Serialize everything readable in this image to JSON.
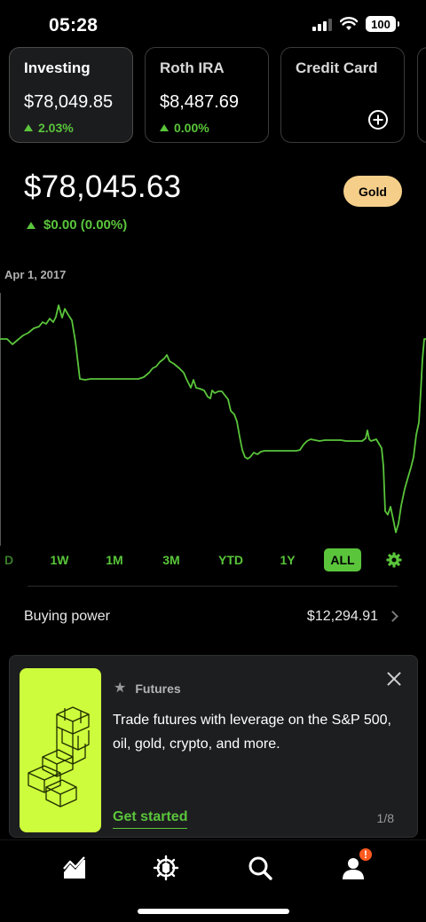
{
  "status_bar": {
    "time": "05:28",
    "battery": "100"
  },
  "accounts": [
    {
      "name": "Investing",
      "value": "$78,049.85",
      "change": "2.03%"
    },
    {
      "name": "Roth IRA",
      "value": "$8,487.69",
      "change": "0.00%"
    },
    {
      "name": "Credit Card",
      "action_icon": "add-circle-icon"
    }
  ],
  "portfolio": {
    "value": "$78,045.63",
    "change": "$0.00 (0.00%)",
    "gold_label": "Gold"
  },
  "chart": {
    "date_label": "Apr 1, 2017",
    "line_color": "#5ac53b"
  },
  "range_tabs": [
    "D",
    "1W",
    "1M",
    "3M",
    "YTD",
    "1Y",
    "ALL"
  ],
  "range_selected": "ALL",
  "buying_power": {
    "label": "Buying power",
    "value": "$12,294.91"
  },
  "promo": {
    "tag": "Futures",
    "text": "Trade futures with leverage on the S&P 500, oil, gold, crypto, and more.",
    "cta": "Get started",
    "pager": "1/8"
  },
  "nav": [
    "chart-icon",
    "crypto-icon",
    "search-icon",
    "account-icon"
  ],
  "nav_badge": "!",
  "colors": {
    "accent": "#5ac53b",
    "gold": "#f5cf8a",
    "promo_art": "#cdfc3c",
    "badge": "#ff5a1f"
  }
}
